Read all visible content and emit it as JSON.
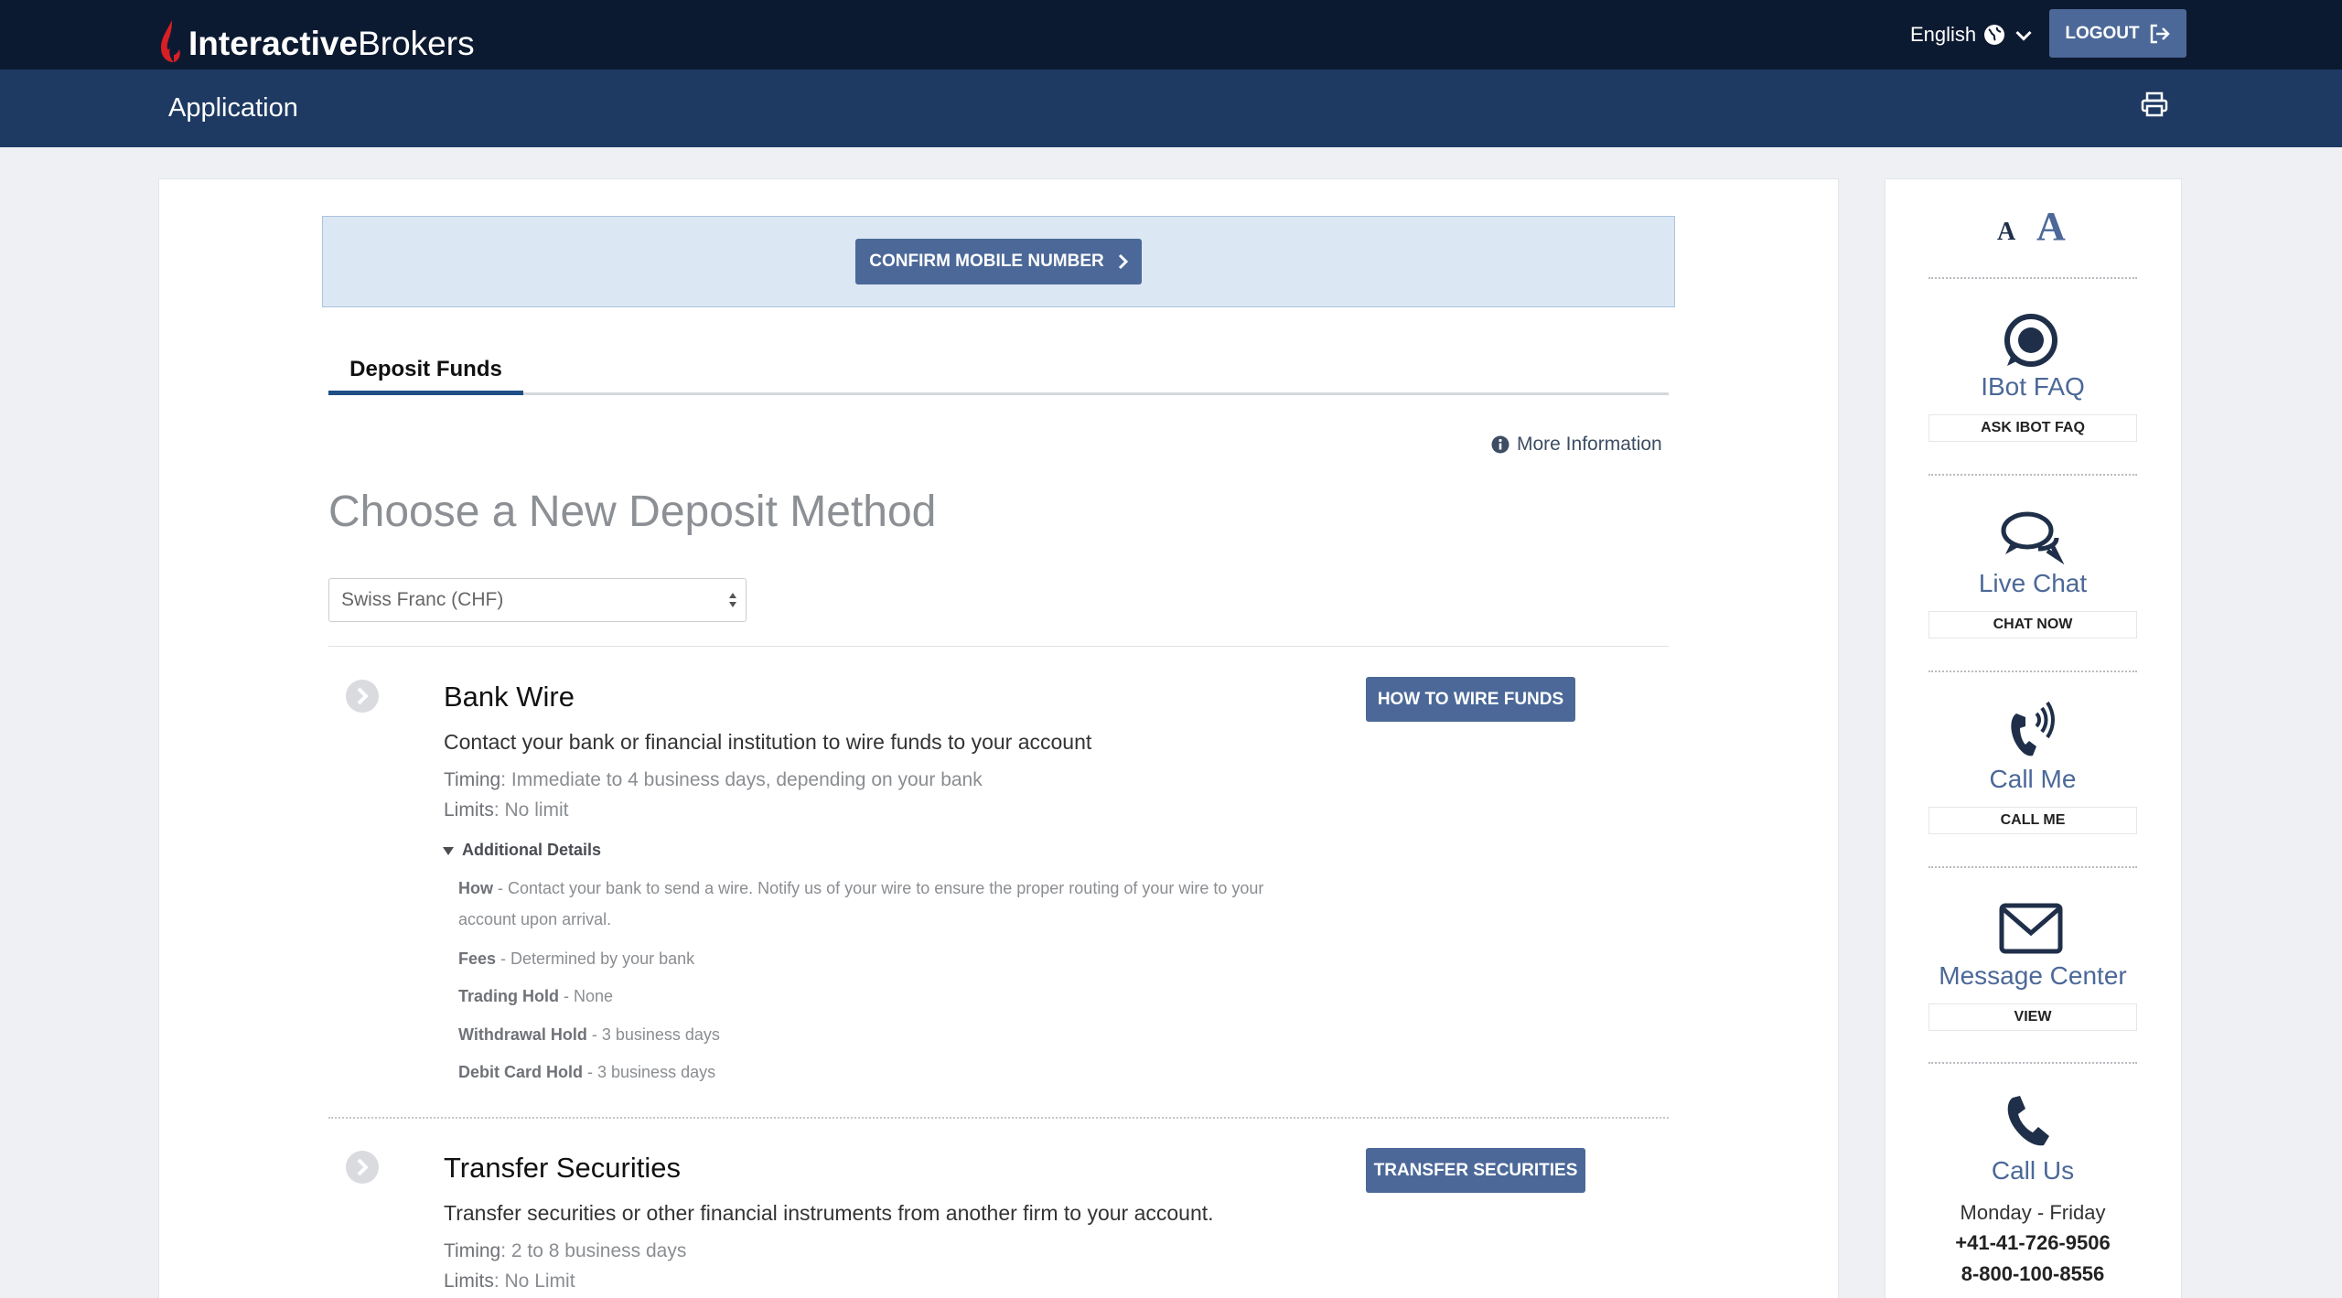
{
  "header": {
    "logo_bold": "Interactive",
    "logo_regular": "Brokers",
    "language": "English",
    "logout_label": "LOGOUT"
  },
  "subheader": {
    "title": "Application"
  },
  "banner": {
    "confirm_label": "CONFIRM MOBILE NUMBER"
  },
  "tabs": [
    {
      "label": "Deposit Funds",
      "active": true
    }
  ],
  "more_info_label": "More Information",
  "heading": "Choose a New Deposit Method",
  "currency_select": {
    "value": "Swiss Franc (CHF)"
  },
  "methods": [
    {
      "title": "Bank Wire",
      "description": "Contact your bank or financial institution to wire funds to your account",
      "timing_label": "Timing",
      "timing_value": ": Immediate to 4 business days, depending on your bank",
      "limits_label": "Limits",
      "limits_value": ": No limit",
      "button_label": "HOW TO WIRE FUNDS",
      "additional_details_label": "Additional Details",
      "details": [
        {
          "key": "How",
          "value": " - Contact your bank to send a wire. Notify us of your wire to ensure the proper routing of your wire to your",
          "value_line2": "account upon arrival."
        },
        {
          "key": "Fees",
          "value": " - Determined by your bank"
        },
        {
          "key": "Trading Hold",
          "value": " - None"
        },
        {
          "key": "Withdrawal Hold",
          "value": " - 3 business days"
        },
        {
          "key": "Debit Card Hold",
          "value": " - 3 business days"
        }
      ]
    },
    {
      "title": "Transfer Securities",
      "description": "Transfer securities or other financial instruments from another firm to your account.",
      "timing_label": "Timing",
      "timing_value": ": 2 to 8 business days",
      "limits_label": "Limits",
      "limits_value": ": No Limit",
      "button_label": "TRANSFER SECURITIES"
    }
  ],
  "sidebar": {
    "font_small": "A",
    "font_large": "A",
    "items": [
      {
        "label": "IBot FAQ",
        "button": "ASK IBOT FAQ",
        "icon": "ibot-icon"
      },
      {
        "label": "Live Chat",
        "button": "CHAT NOW",
        "icon": "chat-icon"
      },
      {
        "label": "Call Me",
        "button": "CALL ME",
        "icon": "call-me-icon"
      },
      {
        "label": "Message Center",
        "button": "VIEW",
        "icon": "envelope-icon"
      },
      {
        "label": "Call Us",
        "icon": "phone-icon"
      }
    ],
    "hours": "Monday - Friday",
    "phones": [
      "+41-41-726-9506",
      "8-800-100-8556"
    ]
  },
  "colors": {
    "topbar": "#0c1a31",
    "subbar": "#1e3a63",
    "accent_button": "#4b6898",
    "brand_red": "#d81f26"
  }
}
